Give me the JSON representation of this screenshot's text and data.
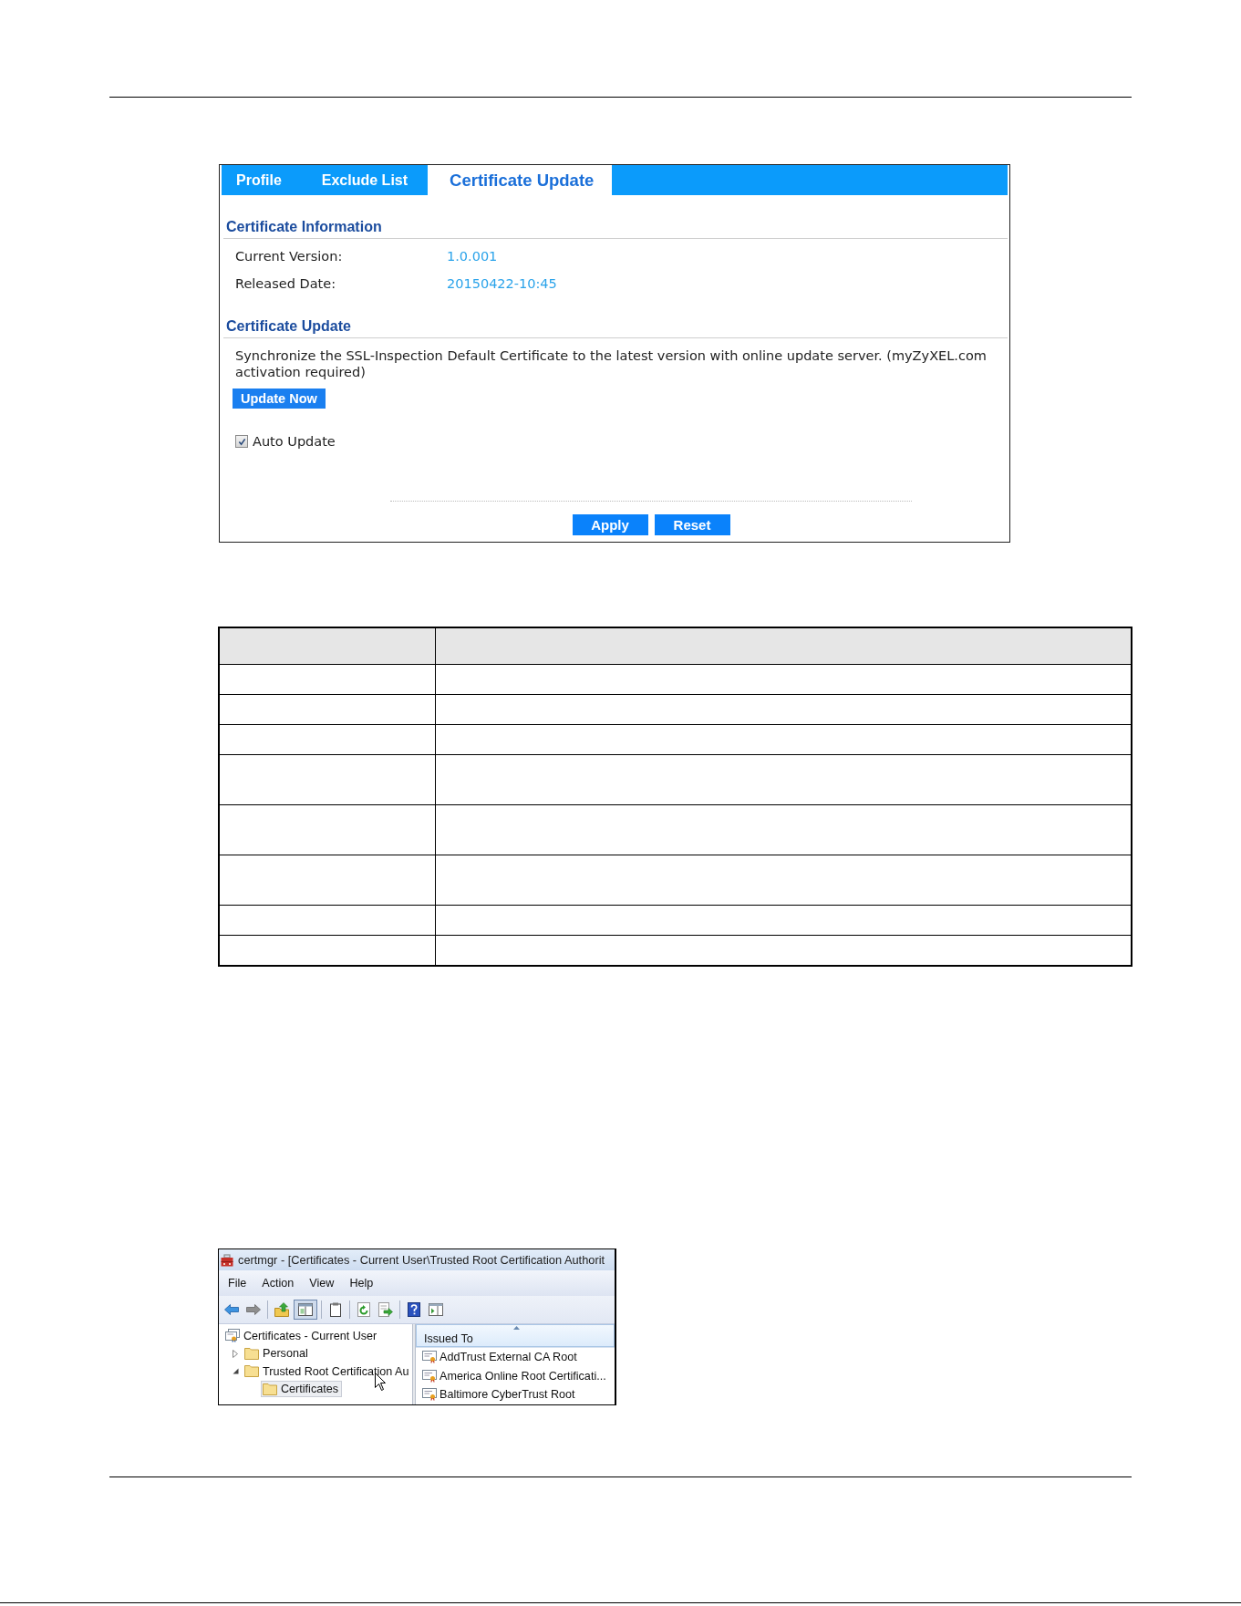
{
  "panel": {
    "tabs": [
      {
        "label": "Profile",
        "selected": false
      },
      {
        "label": "Exclude List",
        "selected": false
      },
      {
        "label": "Certificate Update",
        "selected": true
      }
    ],
    "certificate_information": {
      "heading": "Certificate Information",
      "fields": [
        {
          "label": "Current Version:",
          "value": "1.0.001"
        },
        {
          "label": "Released Date:",
          "value": "20150422-10:45"
        }
      ]
    },
    "certificate_update": {
      "heading": "Certificate Update",
      "description": "Synchronize the SSL-Inspection Default Certificate to the latest version with online update server. (myZyXEL.com activation required)",
      "update_button": "Update Now",
      "auto_update": {
        "label": "Auto Update",
        "checked": true
      }
    },
    "buttons": [
      "Apply",
      "Reset"
    ]
  },
  "certmgr_window": {
    "title": "certmgr - [Certificates - Current User\\Trusted Root Certification Authorit",
    "menu": [
      "File",
      "Action",
      "View",
      "Help"
    ],
    "toolbar_groups": [
      [
        {
          "kind": "back",
          "pressed": false
        },
        {
          "kind": "forward",
          "pressed": false
        }
      ],
      [
        {
          "kind": "up",
          "pressed": false
        },
        {
          "kind": "console-tree",
          "pressed": true
        }
      ],
      [
        {
          "kind": "clipboard",
          "pressed": false
        }
      ],
      [
        {
          "kind": "refresh",
          "pressed": false
        },
        {
          "kind": "export",
          "pressed": false
        }
      ],
      [
        {
          "kind": "help",
          "pressed": false
        },
        {
          "kind": "action-pane",
          "pressed": false
        }
      ]
    ],
    "tree": [
      {
        "label": "Certificates - Current User",
        "kind": "store",
        "selected": false,
        "children": [
          {
            "label": "Personal",
            "kind": "folder",
            "expanded": false,
            "selected": false
          },
          {
            "label": "Trusted Root Certification Au",
            "kind": "folder",
            "expanded": true,
            "selected": false,
            "children": [
              {
                "label": "Certificates",
                "kind": "folder",
                "selected": true
              }
            ]
          }
        ]
      }
    ],
    "columns": [
      {
        "label": "Issued To",
        "sorted": true
      }
    ],
    "rows": [
      "AddTrust External CA Root",
      "America Online Root Certificati...",
      "Baltimore CyberTrust Root"
    ]
  }
}
